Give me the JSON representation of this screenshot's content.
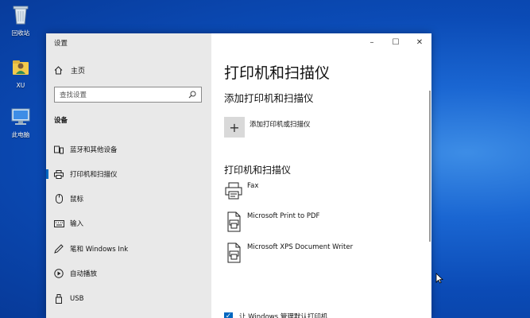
{
  "desktop": {
    "icons": [
      {
        "label": "回收站",
        "icon": "recycle-bin-icon"
      },
      {
        "label": "XU",
        "icon": "user-folder-icon"
      },
      {
        "label": "此电脑",
        "icon": "this-pc-icon"
      }
    ]
  },
  "window": {
    "title": "设置",
    "controls": {
      "minimize": "–",
      "maximize": "☐",
      "close": "✕"
    }
  },
  "sidebar": {
    "home_label": "主页",
    "search_placeholder": "查找设置",
    "section_title": "设备",
    "items": [
      {
        "label": "蓝牙和其他设备",
        "icon": "bluetooth-devices-icon"
      },
      {
        "label": "打印机和扫描仪",
        "icon": "printer-icon",
        "active": true
      },
      {
        "label": "鼠标",
        "icon": "mouse-icon"
      },
      {
        "label": "输入",
        "icon": "keyboard-icon"
      },
      {
        "label": "笔和 Windows Ink",
        "icon": "pen-icon"
      },
      {
        "label": "自动播放",
        "icon": "autoplay-icon"
      },
      {
        "label": "USB",
        "icon": "usb-icon"
      }
    ]
  },
  "main": {
    "title": "打印机和扫描仪",
    "add_section_title": "添加打印机和扫描仪",
    "add_button_label": "添加打印机或扫描仪",
    "list_title": "打印机和扫描仪",
    "printers": [
      {
        "name": "Fax",
        "icon": "fax-printer-icon"
      },
      {
        "name": "Microsoft Print to PDF",
        "icon": "pdf-printer-icon"
      },
      {
        "name": "Microsoft XPS Document Writer",
        "icon": "xps-printer-icon"
      }
    ],
    "default_printer_checkbox": "让 Windows 管理默认打印机"
  },
  "colors": {
    "accent": "#0067c0",
    "sidebar_bg": "#e9e9e9",
    "desktop_blue": "#0b4bb6"
  }
}
